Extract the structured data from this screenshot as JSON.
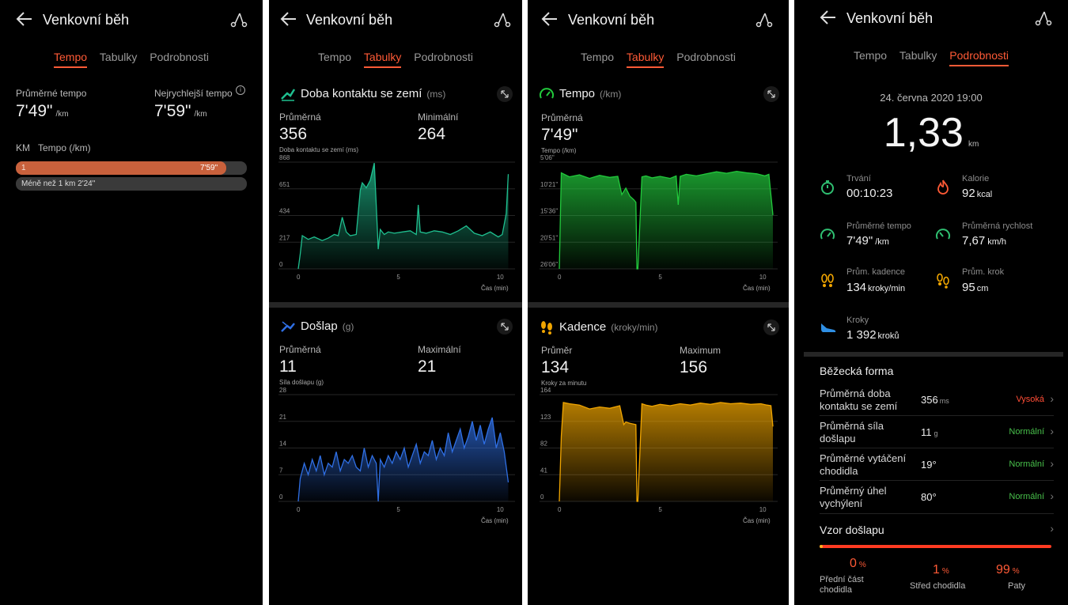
{
  "common": {
    "title": "Venkovní běh",
    "tabs": [
      "Tempo",
      "Tabulky",
      "Podrobnosti"
    ]
  },
  "colors": {
    "accent": "#ff5a36",
    "green": "#2fbf71",
    "contact": "#1fbf8f",
    "impact": "#2f6fe4",
    "tempo": "#22c93c",
    "cadence": "#f0a500",
    "normal": "#48c04b",
    "high": "#ff4d36"
  },
  "s1": {
    "avg_label": "Průměrné tempo",
    "avg_value": "7'49\"",
    "avg_unit": "/km",
    "fast_label": "Nejrychlejší tempo",
    "fast_value": "7'59\"",
    "fast_unit": "/km",
    "km_label": "KM",
    "tempo_label": "Tempo (/km)",
    "bar": {
      "km": "1",
      "value": "7'59\"",
      "fill": 0.91
    },
    "note": "Méně než 1 km 2'24\""
  },
  "s2": {
    "c1": {
      "title": "Doba kontaktu se zemí",
      "unit": "(ms)",
      "avg_label": "Průměrná",
      "avg_value": "356",
      "avg_sub": "Doba kontaktu se zemí (ms)",
      "min_label": "Minimální",
      "min_value": "264",
      "xlabel": "Čas (min)"
    },
    "c2": {
      "title": "Došlap",
      "unit": "(g)",
      "avg_label": "Průměrná",
      "avg_value": "11",
      "avg_sub": "Síla došlapu (g)",
      "max_label": "Maximální",
      "max_value": "21",
      "xlabel": "Čas (min)"
    }
  },
  "s3": {
    "c1": {
      "title": "Tempo",
      "unit": "(/km)",
      "avg_label": "Průměrná",
      "avg_value": "7'49\"",
      "avg_sub": "Tempo (/km)",
      "xlabel": "Čas (min)"
    },
    "c2": {
      "title": "Kadence",
      "unit": "(kroky/min)",
      "avg_label": "Průměr",
      "avg_value": "134",
      "avg_sub": "Kroky za minutu",
      "max_label": "Maximum",
      "max_value": "156",
      "xlabel": "Čas (min)"
    }
  },
  "s4": {
    "date": "24. června 2020 19:00",
    "distance": "1,33",
    "distance_unit": "km",
    "stats": [
      {
        "label": "Trvání",
        "value": "00:10:23",
        "unit": "",
        "icon": "stopwatch-icon"
      },
      {
        "label": "Kalorie",
        "value": "92",
        "unit": "kcal",
        "icon": "flame-icon"
      },
      {
        "label": "Průměrné tempo",
        "value": "7'49\"",
        "unit": "/km",
        "icon": "speedometer-icon"
      },
      {
        "label": "Průměrná rychlost",
        "value": "7,67",
        "unit": "km/h",
        "icon": "speedometer-icon"
      },
      {
        "label": "Prům. kadence",
        "value": "134",
        "unit": "kroky/min",
        "icon": "footprints-icon"
      },
      {
        "label": "Prům. krok",
        "value": "95",
        "unit": "cm",
        "icon": "footprints-icon"
      },
      {
        "label": "Kroky",
        "value": "1 392",
        "unit": "kroků",
        "icon": "shoe-icon"
      }
    ],
    "form_title": "Běžecká forma",
    "form": [
      {
        "label": "Průměrná doba kontaktu se zemí",
        "value": "356",
        "unit": "ms",
        "status": "Vysoká"
      },
      {
        "label": "Průměrná síla došlapu",
        "value": "11",
        "unit": "g",
        "status": "Normální"
      },
      {
        "label": "Průměrné vytáčení chodidla",
        "value": "19°",
        "unit": "",
        "status": "Normální"
      },
      {
        "label": "Průměrný úhel vychýlení",
        "value": "80°",
        "unit": "",
        "status": "Normální"
      }
    ],
    "pattern_label": "Vzor došlapu",
    "pattern": [
      {
        "value": "0",
        "unit": "%",
        "label": "Přední část chodidla"
      },
      {
        "value": "1",
        "unit": "%",
        "label": "Střed chodidla"
      },
      {
        "value": "99",
        "unit": "%",
        "label": "Paty"
      }
    ]
  },
  "chart_data": [
    {
      "type": "area",
      "name": "contact",
      "yticks": [
        "868",
        "651",
        "434",
        "217",
        "0"
      ],
      "ylim": [
        0,
        868
      ],
      "xticks": [
        "0",
        "5",
        "10"
      ],
      "xlim": [
        0,
        10.6
      ],
      "x": [
        0,
        0.1,
        0.2,
        0.5,
        0.8,
        1.2,
        1.5,
        1.8,
        2.0,
        2.2,
        2.4,
        2.6,
        2.9,
        3.1,
        3.2,
        3.4,
        3.6,
        3.8,
        3.9,
        4.0,
        4.1,
        4.3,
        4.5,
        4.8,
        5.2,
        5.6,
        5.9,
        6.0,
        6.1,
        6.4,
        6.8,
        7.2,
        7.6,
        8.0,
        8.4,
        8.8,
        9.2,
        9.6,
        10.0,
        10.2,
        10.4,
        10.5
      ],
      "y": [
        0,
        120,
        270,
        240,
        260,
        230,
        250,
        280,
        270,
        420,
        300,
        270,
        280,
        640,
        700,
        660,
        720,
        860,
        520,
        160,
        320,
        280,
        300,
        290,
        300,
        310,
        280,
        520,
        300,
        290,
        310,
        300,
        280,
        310,
        350,
        290,
        270,
        300,
        260,
        280,
        450,
        770
      ]
    },
    {
      "type": "area",
      "name": "impact",
      "yticks": [
        "28",
        "21",
        "14",
        "7",
        "0"
      ],
      "ylim": [
        0,
        28
      ],
      "xticks": [
        "0",
        "5",
        "10"
      ],
      "xlim": [
        0,
        10.6
      ],
      "x": [
        0,
        0.1,
        0.3,
        0.5,
        0.7,
        0.9,
        1.1,
        1.3,
        1.5,
        1.7,
        1.9,
        2.1,
        2.3,
        2.5,
        2.7,
        2.9,
        3.1,
        3.3,
        3.5,
        3.7,
        3.9,
        4.0,
        4.1,
        4.3,
        4.5,
        4.7,
        4.9,
        5.1,
        5.3,
        5.5,
        5.7,
        5.9,
        6.1,
        6.3,
        6.5,
        6.7,
        6.9,
        7.1,
        7.3,
        7.5,
        7.7,
        7.9,
        8.1,
        8.3,
        8.5,
        8.7,
        8.9,
        9.1,
        9.3,
        9.5,
        9.7,
        9.9,
        10.1,
        10.3,
        10.5
      ],
      "y": [
        0,
        6,
        10,
        7,
        11,
        8,
        12,
        7,
        10,
        9,
        13,
        8,
        11,
        10,
        12,
        9,
        8,
        14,
        9,
        12,
        10,
        0,
        11,
        9,
        12,
        10,
        13,
        11,
        14,
        9,
        12,
        15,
        10,
        13,
        12,
        16,
        11,
        14,
        12,
        18,
        13,
        16,
        19,
        14,
        17,
        21,
        16,
        20,
        15,
        19,
        22,
        14,
        18,
        13,
        5
      ]
    },
    {
      "type": "area",
      "name": "tempo",
      "yticks": [
        "5'06\"",
        "10'21\"",
        "15'36\"",
        "20'51\"",
        "26'06\""
      ],
      "ylim": [
        5.1,
        26.1
      ],
      "invert": true,
      "xticks": [
        "0",
        "5",
        "10"
      ],
      "xlim": [
        0,
        10.6
      ],
      "x": [
        0,
        0.1,
        0.5,
        1.0,
        1.5,
        2.0,
        2.5,
        2.9,
        3.1,
        3.3,
        3.5,
        3.7,
        3.8,
        3.85,
        3.9,
        4.1,
        4.3,
        4.6,
        5.0,
        5.5,
        5.8,
        5.9,
        6.0,
        6.3,
        6.8,
        7.3,
        7.8,
        8.3,
        8.8,
        9.3,
        9.8,
        10.2,
        10.4,
        10.6
      ],
      "y": [
        26.1,
        7.2,
        8.0,
        7.6,
        8.3,
        7.7,
        8.1,
        7.9,
        11.5,
        10.2,
        11.8,
        12.5,
        13.0,
        26.1,
        26.1,
        8.0,
        7.8,
        8.2,
        7.9,
        8.3,
        7.8,
        13.5,
        7.9,
        7.5,
        7.8,
        7.4,
        7.0,
        7.3,
        6.9,
        7.2,
        7.4,
        7.8,
        7.5,
        15.5
      ]
    },
    {
      "type": "area",
      "name": "cadence",
      "yticks": [
        "164",
        "123",
        "82",
        "41",
        "0"
      ],
      "ylim": [
        0,
        164
      ],
      "xticks": [
        "0",
        "5",
        "10"
      ],
      "xlim": [
        0,
        10.6
      ],
      "x": [
        0,
        0.1,
        0.2,
        0.5,
        1.0,
        1.5,
        2.0,
        2.5,
        3.0,
        3.2,
        3.3,
        3.5,
        3.8,
        3.85,
        3.9,
        4.1,
        4.3,
        4.6,
        5.0,
        5.5,
        6.0,
        6.5,
        7.0,
        7.5,
        8.0,
        8.5,
        9.0,
        9.5,
        10.0,
        10.3,
        10.5,
        10.6
      ],
      "y": [
        0,
        100,
        152,
        150,
        148,
        142,
        145,
        143,
        147,
        118,
        122,
        120,
        118,
        0,
        0,
        150,
        148,
        146,
        149,
        147,
        150,
        148,
        151,
        149,
        152,
        150,
        151,
        149,
        150,
        148,
        147,
        115
      ]
    }
  ]
}
